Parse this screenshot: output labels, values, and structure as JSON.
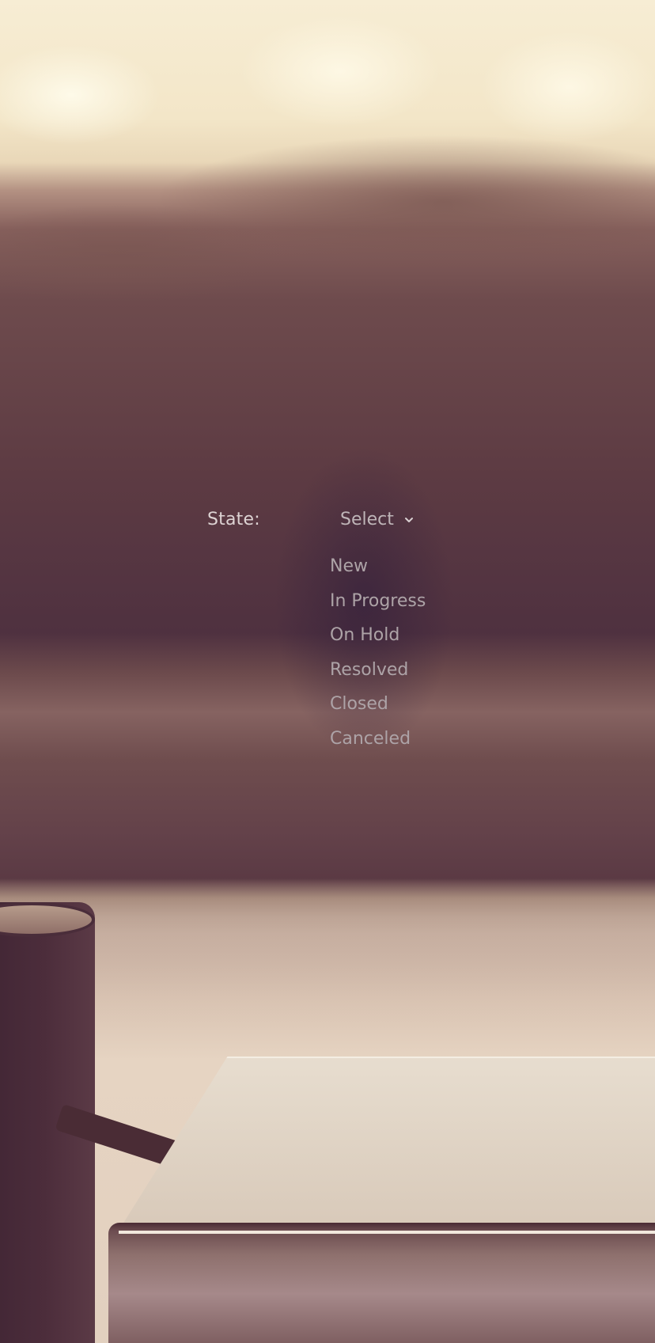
{
  "form": {
    "state_label": "State:",
    "select": {
      "selected_value": "Select",
      "chevron_icon": "chevron-down-icon",
      "options": [
        "New",
        "In Progress",
        "On Hold",
        "Resolved",
        "Closed",
        "Canceled"
      ]
    }
  },
  "colors": {
    "label_text": "#ddd3d3",
    "select_text": "#bfb5b8",
    "option_text": "#ada3a7"
  }
}
